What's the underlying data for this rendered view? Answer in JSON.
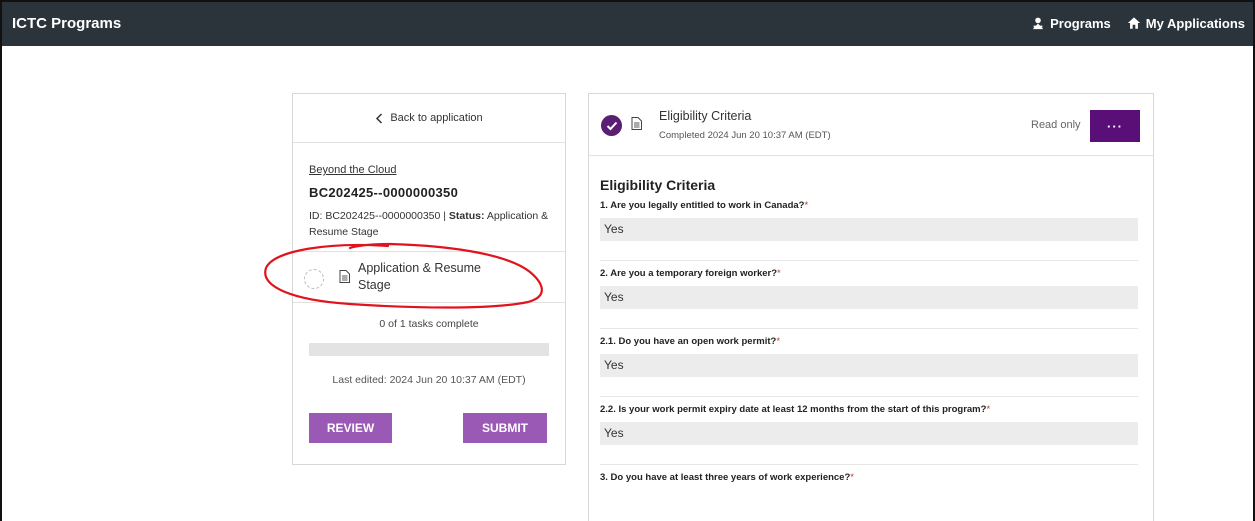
{
  "header": {
    "brand": "ICTC Programs",
    "nav": [
      {
        "label": "Programs",
        "icon": "programs-icon"
      },
      {
        "label": "My Applications",
        "icon": "home-icon"
      }
    ]
  },
  "left_card": {
    "back_label": "Back to application",
    "org_name": "Beyond the Cloud",
    "app_code": "BC202425--0000000350",
    "meta_id_prefix": "ID: ",
    "meta_id": "BC202425--0000000350",
    "meta_sep": " | ",
    "meta_status_label": "Status:",
    "meta_status": " Application & Resume Stage",
    "stage_label": "Application & Resume Stage",
    "tasks_text": "0 of 1 tasks complete",
    "progress_fraction": 0,
    "last_edited": "Last edited: 2024 Jun 20 10:37 AM (EDT)",
    "review_label": "REVIEW",
    "submit_label": "SUBMIT"
  },
  "right_card": {
    "title": "Eligibility Criteria",
    "subtitle": "Completed 2024 Jun 20 10:37 AM (EDT)",
    "read_only": "Read only",
    "more_label": "···",
    "form_title": "Eligibility Criteria",
    "questions": [
      {
        "label": "1. Are you legally entitled to work in Canada?",
        "answer": "Yes"
      },
      {
        "label": "2. Are you a temporary foreign worker?",
        "answer": "Yes"
      },
      {
        "label": "2.1. Do you have an open work permit?",
        "answer": "Yes"
      },
      {
        "label": "2.2. Is your work permit expiry date at least 12 months from the start of this program?",
        "answer": "Yes"
      },
      {
        "label": "3. Do you have at least three years of work experience?",
        "answer": ""
      }
    ],
    "required_mark": "*"
  },
  "colors": {
    "topbar": "#2b333b",
    "accent_purple": "#5a0e78",
    "button_purple": "#9b59b6",
    "annotation_red": "#e0141e"
  }
}
